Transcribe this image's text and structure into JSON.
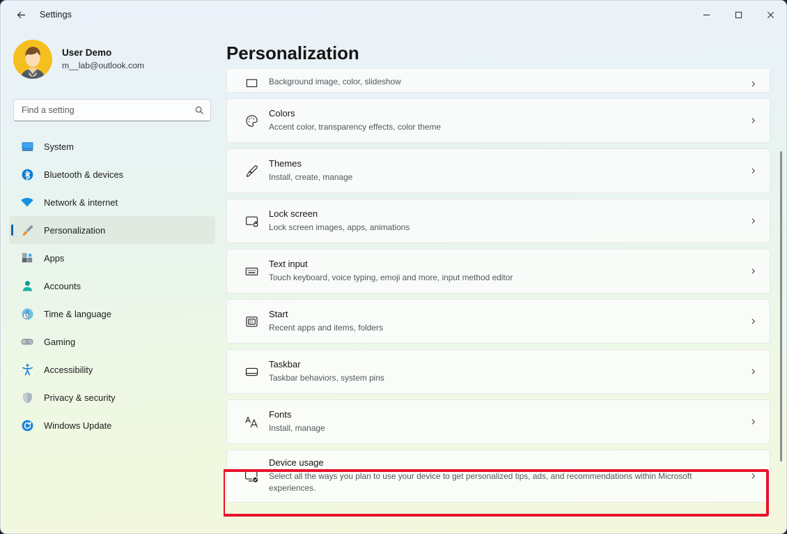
{
  "titlebar": {
    "back_label": "back-arrow",
    "title": "Settings",
    "minimize": "minimize",
    "maximize": "maximize",
    "close": "close"
  },
  "sidebar": {
    "account": {
      "name": "User Demo",
      "email": "m__lab@outlook.com",
      "avatar_bg": "#f5bf1f"
    },
    "search": {
      "value": "",
      "placeholder": "Find a setting",
      "icon": "search-icon"
    },
    "items": [
      {
        "label": "System",
        "icon": "system-icon",
        "selected": false
      },
      {
        "label": "Bluetooth & devices",
        "icon": "bluetooth-icon",
        "selected": false
      },
      {
        "label": "Network & internet",
        "icon": "wifi-icon",
        "selected": false
      },
      {
        "label": "Personalization",
        "icon": "paintbrush-icon",
        "selected": true
      },
      {
        "label": "Apps",
        "icon": "apps-icon",
        "selected": false
      },
      {
        "label": "Accounts",
        "icon": "person-icon",
        "selected": false
      },
      {
        "label": "Time & language",
        "icon": "clock-globe-icon",
        "selected": false
      },
      {
        "label": "Gaming",
        "icon": "gamepad-icon",
        "selected": false
      },
      {
        "label": "Accessibility",
        "icon": "accessibility-icon",
        "selected": false
      },
      {
        "label": "Privacy & security",
        "icon": "shield-icon",
        "selected": false
      },
      {
        "label": "Windows Update",
        "icon": "update-icon",
        "selected": false
      }
    ]
  },
  "main": {
    "page_title": "Personalization",
    "rows": [
      {
        "title": "",
        "sub": "Background image, color, slideshow",
        "icon": "background-icon",
        "clipped": true,
        "highlighted": false
      },
      {
        "title": "Colors",
        "sub": "Accent color, transparency effects, color theme",
        "icon": "palette-icon",
        "clipped": false,
        "highlighted": false
      },
      {
        "title": "Themes",
        "sub": "Install, create, manage",
        "icon": "paintbrush-icon",
        "clipped": false,
        "highlighted": false
      },
      {
        "title": "Lock screen",
        "sub": "Lock screen images, apps, animations",
        "icon": "lock-screen-icon",
        "clipped": false,
        "highlighted": false
      },
      {
        "title": "Text input",
        "sub": "Touch keyboard, voice typing, emoji and more, input method editor",
        "icon": "keyboard-icon",
        "clipped": false,
        "highlighted": false
      },
      {
        "title": "Start",
        "sub": "Recent apps and items, folders",
        "icon": "start-icon",
        "clipped": false,
        "highlighted": false
      },
      {
        "title": "Taskbar",
        "sub": "Taskbar behaviors, system pins",
        "icon": "taskbar-icon",
        "clipped": false,
        "highlighted": false
      },
      {
        "title": "Fonts",
        "sub": "Install, manage",
        "icon": "fonts-icon",
        "clipped": false,
        "highlighted": true
      },
      {
        "title": "Device usage",
        "sub": "Select all the ways you plan to use your device to get personalized tips, ads, and recommendations within Microsoft experiences.",
        "icon": "device-usage-icon",
        "clipped": false,
        "highlighted": false
      }
    ],
    "chevron_icon": "chevron-right-icon",
    "highlight_color": "#e8112d"
  },
  "scrollbar": {
    "name": "vertical-scrollbar"
  }
}
